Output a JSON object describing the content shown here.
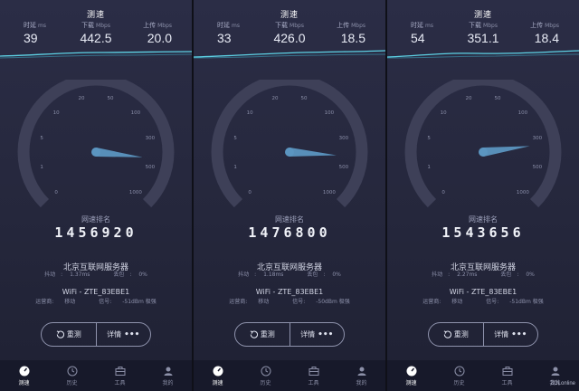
{
  "title": "测速",
  "labels": {
    "ping": "时延",
    "ping_unit": "ms",
    "download": "下载",
    "upload": "上传",
    "speed_unit": "Mbps",
    "rank": "网速排名",
    "jitter": "抖动",
    "loss": "丢包",
    "carrier_prefix": "运营商:",
    "signal_prefix": "信号:"
  },
  "gauge": {
    "ticks": [
      "0",
      "1",
      "5",
      "10",
      "20",
      "50",
      "100",
      "300",
      "500",
      "1000"
    ],
    "accent_color": "#5b95c0",
    "track_color": "#3e4058"
  },
  "buttons": {
    "retest": "重测",
    "details": "详情"
  },
  "tabs": [
    "测速",
    "历史",
    "工具",
    "我的"
  ],
  "panels": [
    {
      "ping": "39",
      "download": "442.5",
      "upload": "20.0",
      "rank": "1456920",
      "server": "北京互联网服务器",
      "jitter": "1.37ms",
      "loss": "0%",
      "wifi": "WiFi - ZTE_83EBE1",
      "carrier": "移动",
      "signal": "-51dBm 极强",
      "needle_value": 442.5
    },
    {
      "ping": "33",
      "download": "426.0",
      "upload": "18.5",
      "rank": "1476800",
      "server": "北京互联网服务器",
      "jitter": "1.18ms",
      "loss": "0%",
      "wifi": "WiFi - ZTE_83EBE1",
      "carrier": "移动",
      "signal": "-50dBm 极强",
      "needle_value": 426.0
    },
    {
      "ping": "54",
      "download": "351.1",
      "upload": "18.4",
      "rank": "1543656",
      "server": "北京互联网服务器",
      "jitter": "2.27ms",
      "loss": "0%",
      "wifi": "WiFi - ZTE_83EBE1",
      "carrier": "移动",
      "signal": "-51dBm 极强",
      "needle_value": 351.1
    }
  ],
  "watermark": "ZOLonline"
}
